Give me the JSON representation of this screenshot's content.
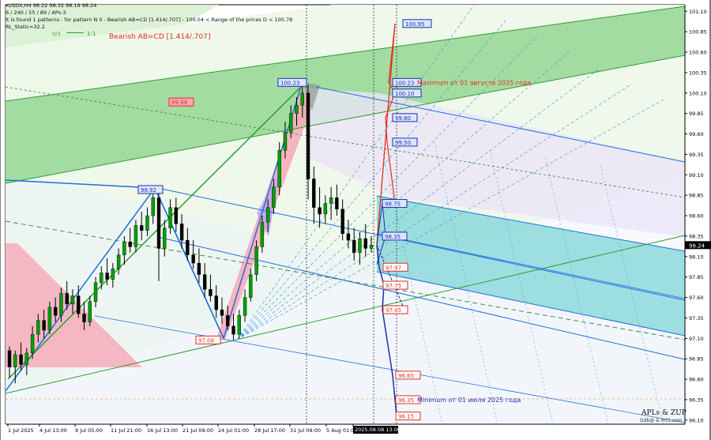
{
  "header": {
    "line1": "▾USDX,H4  98.22 98.32 98.19 98.24",
    "line2": "6 / 240 / 55 / 89 / APs-3",
    "line3": "It is found 1 patterns  -  for pattern N 0 - Bearish AB=CD [1.414/.707] - 100.04 < Range of the prices D < 100.78",
    "line4": "RL_Static=32.2",
    "line5_a": "0/3",
    "line5_b": "1-1",
    "pattern_label": "Bearish AB=CD [1.414/.707]"
  },
  "signature": {
    "line1": "APLs & ZUP",
    "line2": "Gdb@ & mt5.com"
  },
  "colors": {
    "bull": "#00a000",
    "bear": "#000000",
    "blue_zigzag": "#1e6fe0",
    "green_zigzag": "#2e9e2e",
    "target_up": "#e03020",
    "target_down": "#1e30b0",
    "price_tag": "#000000",
    "cyan_channel": "#7fd4d8",
    "green_channel": "#8ed58e",
    "pink": "#f7a8b8",
    "lavender": "#b9a6e8"
  },
  "chart_data": {
    "type": "candlestick",
    "symbol": "USDX",
    "timeframe": "H4",
    "y_ticks": [
      101.1,
      100.85,
      100.6,
      100.35,
      100.1,
      99.85,
      99.6,
      99.35,
      99.1,
      98.85,
      98.6,
      98.35,
      98.1,
      97.85,
      97.6,
      97.35,
      97.1,
      96.85,
      96.6,
      96.35,
      96.1
    ],
    "ylim": [
      96.05,
      101.18
    ],
    "current_price": "98.24",
    "x_ticks": [
      "1 Jul 2025",
      "4 Jul 13:00",
      "9 Jul 05:00",
      "11 Jul 21:00",
      "16 Jul 13:00",
      "21 Jul 09:00",
      "24 Jul 01:00",
      "28 Jul 17:00",
      "31 Jul 09:00",
      "5 Aug 01:00",
      "2025.08.08 13:00"
    ],
    "pivots": [
      {
        "label": "98.92",
        "value": 98.92
      },
      {
        "label": "97.08",
        "value": 97.08
      },
      {
        "label": "100.23",
        "value": 100.23
      },
      {
        "label": "99.99",
        "value": 99.99
      }
    ],
    "targets_up": [
      "100.95",
      "100.23",
      "100.10",
      "99.80",
      "99.50"
    ],
    "targets_mid": [
      "98.75",
      "98.35"
    ],
    "targets_down": [
      "97.97",
      "97.75",
      "97.45",
      "96.65",
      "96.35",
      "96.15"
    ],
    "annotations": {
      "max": "Maximum от 01 августа 2025 года",
      "min": "Minimum от 01 июля 2025 года"
    },
    "candles": [
      [
        96.95,
        97.0,
        96.62,
        96.75
      ],
      [
        96.75,
        96.95,
        96.55,
        96.9
      ],
      [
        96.9,
        97.05,
        96.7,
        96.78
      ],
      [
        96.78,
        96.98,
        96.65,
        96.92
      ],
      [
        96.92,
        97.25,
        96.85,
        97.15
      ],
      [
        97.15,
        97.4,
        97.05,
        97.32
      ],
      [
        97.32,
        97.45,
        97.1,
        97.2
      ],
      [
        97.2,
        97.55,
        97.15,
        97.48
      ],
      [
        97.48,
        97.6,
        97.3,
        97.38
      ],
      [
        97.38,
        97.72,
        97.3,
        97.65
      ],
      [
        97.65,
        97.8,
        97.45,
        97.52
      ],
      [
        97.52,
        97.7,
        97.4,
        97.62
      ],
      [
        97.62,
        97.75,
        97.35,
        97.4
      ],
      [
        97.4,
        97.55,
        97.2,
        97.3
      ],
      [
        97.3,
        97.62,
        97.25,
        97.55
      ],
      [
        97.55,
        97.85,
        97.48,
        97.78
      ],
      [
        97.78,
        97.98,
        97.7,
        97.9
      ],
      [
        97.9,
        98.08,
        97.75,
        97.82
      ],
      [
        97.82,
        98.02,
        97.72,
        97.95
      ],
      [
        97.95,
        98.2,
        97.88,
        98.12
      ],
      [
        98.12,
        98.35,
        98.0,
        98.28
      ],
      [
        98.28,
        98.45,
        98.15,
        98.22
      ],
      [
        98.22,
        98.55,
        98.15,
        98.48
      ],
      [
        98.48,
        98.65,
        98.3,
        98.42
      ],
      [
        98.42,
        98.7,
        98.35,
        98.6
      ],
      [
        98.6,
        98.92,
        98.5,
        98.82
      ],
      [
        98.82,
        98.9,
        97.8,
        98.2
      ],
      [
        98.2,
        98.55,
        98.1,
        98.45
      ],
      [
        98.45,
        98.8,
        98.38,
        98.7
      ],
      [
        98.7,
        98.82,
        98.4,
        98.5
      ],
      [
        98.5,
        98.62,
        98.2,
        98.3
      ],
      [
        98.3,
        98.45,
        98.05,
        98.12
      ],
      [
        98.12,
        98.3,
        97.95,
        98.02
      ],
      [
        98.02,
        98.2,
        97.78,
        97.88
      ],
      [
        97.88,
        98.02,
        97.6,
        97.7
      ],
      [
        97.7,
        97.88,
        97.55,
        97.62
      ],
      [
        97.62,
        97.75,
        97.35,
        97.45
      ],
      [
        97.45,
        97.6,
        97.28,
        97.38
      ],
      [
        97.38,
        97.5,
        97.2,
        97.25
      ],
      [
        97.25,
        97.4,
        97.08,
        97.15
      ],
      [
        97.15,
        97.45,
        97.1,
        97.38
      ],
      [
        97.38,
        97.7,
        97.3,
        97.6
      ],
      [
        97.6,
        97.95,
        97.55,
        97.88
      ],
      [
        97.88,
        98.3,
        97.8,
        98.22
      ],
      [
        98.22,
        98.6,
        98.15,
        98.52
      ],
      [
        98.52,
        98.8,
        98.4,
        98.7
      ],
      [
        98.7,
        99.05,
        98.62,
        98.95
      ],
      [
        98.95,
        99.5,
        98.85,
        99.4
      ],
      [
        99.4,
        99.75,
        99.3,
        99.62
      ],
      [
        99.62,
        99.95,
        99.55,
        99.85
      ],
      [
        99.85,
        100.05,
        99.7,
        99.95
      ],
      [
        99.95,
        100.23,
        99.8,
        100.1
      ],
      [
        100.1,
        100.2,
        98.8,
        99.05
      ],
      [
        99.05,
        99.2,
        98.5,
        98.7
      ],
      [
        98.7,
        98.95,
        98.45,
        98.62
      ],
      [
        98.62,
        98.85,
        98.5,
        98.75
      ],
      [
        98.75,
        98.95,
        98.55,
        98.82
      ],
      [
        98.82,
        98.98,
        98.6,
        98.68
      ],
      [
        98.68,
        98.8,
        98.3,
        98.38
      ],
      [
        98.38,
        98.55,
        98.2,
        98.3
      ],
      [
        98.3,
        98.45,
        98.05,
        98.15
      ],
      [
        98.15,
        98.4,
        98.0,
        98.32
      ],
      [
        98.32,
        98.5,
        98.1,
        98.2
      ],
      [
        98.2,
        98.35,
        98.15,
        98.24
      ]
    ]
  }
}
